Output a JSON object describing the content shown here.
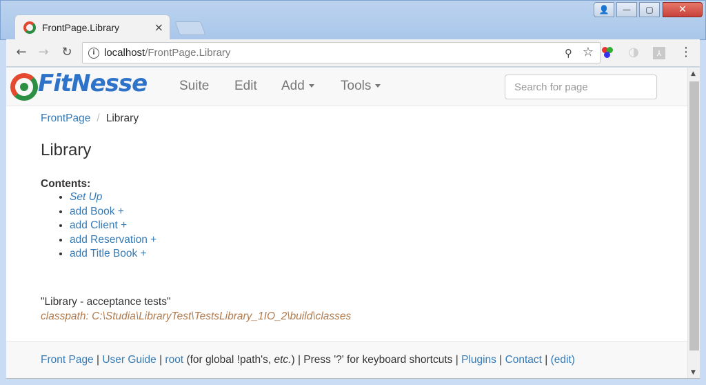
{
  "browser": {
    "tab": {
      "title": "FrontPage.Library",
      "close_glyph": "×"
    },
    "window_controls": {
      "user": "👤",
      "minimize": "—",
      "maximize": "▢",
      "close": "✕"
    },
    "nav": {
      "back": "←",
      "forward": "→",
      "reload": "↻"
    },
    "address": {
      "host": "localhost",
      "path": "/FrontPage.Library"
    },
    "icons": {
      "info": "i",
      "zoom": "⚲",
      "star": "☆",
      "menu": "⋮",
      "circle": "◑",
      "pdf": "⅄"
    }
  },
  "app": {
    "logo_text": "FitNesse",
    "nav": {
      "suite": "Suite",
      "edit": "Edit",
      "add": "Add",
      "tools": "Tools"
    },
    "search_placeholder": "Search for page",
    "breadcrumb": {
      "parent": "FrontPage",
      "separator": "/",
      "current": "Library"
    },
    "page_title": "Library",
    "contents_label": "Contents:",
    "contents": [
      {
        "label": "Set Up",
        "italic": true
      },
      {
        "label": "add Book +"
      },
      {
        "label": "add Client +"
      },
      {
        "label": "add Reservation +"
      },
      {
        "label": "add Title Book +"
      }
    ],
    "description": "\"Library - acceptance tests\"",
    "classpath": "classpath: C:\\Studia\\LibraryTest\\TestsLibrary_1IO_2\\build\\classes"
  },
  "footer": {
    "front_page": "Front Page",
    "sep": "|",
    "user_guide": "User Guide",
    "root": "root",
    "root_note_before": "(for global !path's, ",
    "root_note_etc": "etc.",
    "root_note_after": ")",
    "shortcut_note": "Press '?' for keyboard shortcuts",
    "plugins": "Plugins",
    "contact": "Contact",
    "edit": "(edit)"
  },
  "colors": {
    "link": "#337ab7",
    "classpath": "#b07a4c",
    "logo_blue": "#2f73c8",
    "logo_red": "#e34a2f",
    "logo_green": "#2d8f43"
  }
}
